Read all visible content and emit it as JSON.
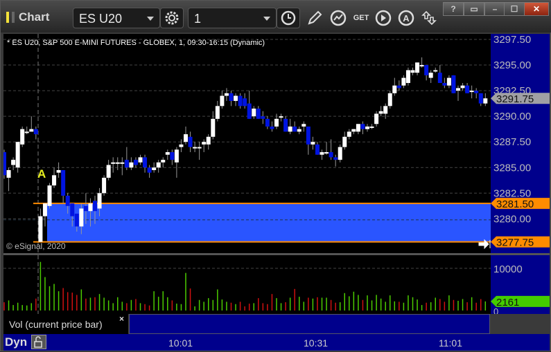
{
  "window": {
    "title": "Chart",
    "help": "?",
    "controls": [
      "restore-down",
      "minimize",
      "maximize",
      "close"
    ]
  },
  "toolbar": {
    "symbol": "ES U20",
    "interval": "1",
    "tools": [
      "gear-icon",
      "clock-icon",
      "pencil-icon",
      "studies-icon",
      "get-icon",
      "play-icon",
      "alert-icon",
      "link-arrows-icon"
    ]
  },
  "chart": {
    "legend": "* ES U20, S&P 500 E-MINI FUTURES - GLOBEX, 1, 09:30-16:15 (Dynamic)",
    "copyright": "© eSignal, 2020",
    "marker": "A",
    "price_ticks": [
      "3297.50",
      "3295.00",
      "3292.50",
      "3290.00",
      "3287.50",
      "3285.00",
      "3282.50",
      "3280.00"
    ],
    "price_tick_values": [
      3297.5,
      3295,
      3292.5,
      3290,
      3287.5,
      3285,
      3282.5,
      3280
    ],
    "last_price": "3291.75",
    "range_high": "3281.50",
    "range_low": "3277.75",
    "range_values": [
      3281.5,
      3277.75
    ],
    "colors": {
      "up": "#ffffff",
      "down": "#0014e0",
      "range_fill": "#2a55ff",
      "range_line": "#ff8c00",
      "axis_bg": "#00008c",
      "last_tag": "#a0a0a4",
      "vol_up": "#4ccc00",
      "vol_down": "#d01010",
      "vol_tag": "#44cc00"
    },
    "candles_ohlc": [
      [
        3286.5,
        3286.75,
        3283.9,
        3284.25
      ],
      [
        3284.0,
        3285.0,
        3282.7,
        3284.75
      ],
      [
        3285.25,
        3286.0,
        3284.75,
        3285.75
      ],
      [
        3285.0,
        3287.5,
        3284.5,
        3287.5
      ],
      [
        3287.25,
        3289.0,
        3287.0,
        3288.75
      ],
      [
        3288.5,
        3289.0,
        3288.25,
        3288.5
      ],
      [
        3288.5,
        3290.0,
        3288.5,
        3288.75
      ],
      [
        3288.75,
        3289.0,
        3287.75,
        3288.25
      ],
      [
        3277.75,
        3281.0,
        3277.75,
        3280.25
      ],
      [
        3280.25,
        3281.5,
        3279.25,
        3281.5
      ],
      [
        3281.25,
        3283.5,
        3281.0,
        3283.25
      ],
      [
        3283.25,
        3285.0,
        3283.0,
        3284.25
      ],
      [
        3284.5,
        3285.5,
        3284.0,
        3284.75
      ],
      [
        3284.75,
        3284.75,
        3281.5,
        3282.25
      ],
      [
        3282.25,
        3282.5,
        3280.5,
        3281.25
      ],
      [
        3281.5,
        3281.5,
        3279.25,
        3280.25
      ],
      [
        3280.5,
        3280.5,
        3278.75,
        3279.25
      ],
      [
        3279.25,
        3281.5,
        3278.5,
        3281.0
      ],
      [
        3281.25,
        3282.5,
        3279.5,
        3280.75
      ],
      [
        3280.75,
        3282.0,
        3279.25,
        3281.5
      ],
      [
        3281.75,
        3282.25,
        3279.5,
        3280.75
      ],
      [
        3281.0,
        3283.0,
        3280.25,
        3282.5
      ],
      [
        3282.5,
        3284.25,
        3282.25,
        3284.0
      ],
      [
        3284.0,
        3285.75,
        3283.75,
        3285.25
      ],
      [
        3285.5,
        3286.0,
        3284.5,
        3285.5
      ],
      [
        3285.5,
        3286.0,
        3284.75,
        3285.5
      ],
      [
        3285.5,
        3286.0,
        3284.25,
        3285.5
      ],
      [
        3285.75,
        3287.0,
        3284.75,
        3285.0
      ],
      [
        3285.0,
        3286.0,
        3284.75,
        3285.5
      ],
      [
        3285.75,
        3286.0,
        3285.0,
        3285.25
      ],
      [
        3285.5,
        3286.25,
        3285.25,
        3286.0
      ],
      [
        3286.0,
        3286.25,
        3284.5,
        3285.0
      ],
      [
        3285.0,
        3285.25,
        3284.0,
        3284.5
      ],
      [
        3284.75,
        3285.5,
        3284.5,
        3285.0
      ],
      [
        3285.0,
        3285.75,
        3284.5,
        3285.5
      ],
      [
        3285.5,
        3286.0,
        3285.0,
        3285.75
      ],
      [
        3286.25,
        3286.75,
        3285.75,
        3286.5
      ],
      [
        3286.5,
        3286.75,
        3285.25,
        3285.75
      ],
      [
        3285.5,
        3287.0,
        3284.0,
        3286.75
      ],
      [
        3287.0,
        3287.75,
        3286.5,
        3287.25
      ],
      [
        3287.5,
        3289.0,
        3287.25,
        3288.25
      ],
      [
        3288.0,
        3288.5,
        3286.5,
        3287.0
      ],
      [
        3287.0,
        3287.5,
        3286.5,
        3287.0
      ],
      [
        3287.0,
        3287.5,
        3285.75,
        3287.0
      ],
      [
        3287.25,
        3287.75,
        3286.5,
        3287.5
      ],
      [
        3287.25,
        3288.25,
        3286.75,
        3288.0
      ],
      [
        3288.0,
        3290.5,
        3287.75,
        3289.75
      ],
      [
        3289.75,
        3291.5,
        3289.5,
        3291.0
      ],
      [
        3291.0,
        3292.5,
        3290.75,
        3292.0
      ],
      [
        3292.0,
        3292.75,
        3291.5,
        3292.25
      ],
      [
        3292.25,
        3292.5,
        3291.0,
        3291.5
      ],
      [
        3291.5,
        3292.25,
        3291.0,
        3292.0
      ],
      [
        3292.0,
        3292.25,
        3290.75,
        3291.0
      ],
      [
        3291.75,
        3292.25,
        3290.75,
        3291.0
      ],
      [
        3291.25,
        3292.5,
        3289.75,
        3289.75
      ],
      [
        3290.0,
        3291.0,
        3289.75,
        3290.75
      ],
      [
        3290.75,
        3291.0,
        3289.75,
        3289.75
      ],
      [
        3290.0,
        3290.5,
        3289.25,
        3289.75
      ],
      [
        3289.75,
        3290.0,
        3288.75,
        3289.0
      ],
      [
        3289.0,
        3289.5,
        3288.5,
        3288.75
      ],
      [
        3289.0,
        3290.25,
        3288.75,
        3289.75
      ],
      [
        3290.0,
        3290.25,
        3289.5,
        3290.0
      ],
      [
        3289.75,
        3290.0,
        3288.5,
        3288.5
      ],
      [
        3288.5,
        3289.75,
        3288.25,
        3289.0
      ],
      [
        3289.0,
        3289.5,
        3288.5,
        3288.5
      ],
      [
        3288.5,
        3289.0,
        3288.25,
        3288.75
      ],
      [
        3289.0,
        3289.5,
        3288.5,
        3289.25
      ],
      [
        3289.0,
        3289.0,
        3286.25,
        3287.25
      ],
      [
        3287.25,
        3288.0,
        3286.75,
        3287.5
      ],
      [
        3287.25,
        3287.5,
        3286.25,
        3286.25
      ],
      [
        3286.25,
        3286.75,
        3285.75,
        3286.5
      ],
      [
        3286.5,
        3287.5,
        3286.25,
        3286.5
      ],
      [
        3286.5,
        3287.75,
        3285.75,
        3286.0
      ],
      [
        3286.0,
        3286.25,
        3285.1,
        3285.75
      ],
      [
        3285.75,
        3287.25,
        3285.5,
        3287.0
      ],
      [
        3287.0,
        3288.5,
        3286.75,
        3288.0
      ],
      [
        3288.0,
        3288.75,
        3287.75,
        3288.5
      ],
      [
        3288.5,
        3288.75,
        3288.25,
        3288.75
      ],
      [
        3288.5,
        3289.25,
        3288.25,
        3289.25
      ],
      [
        3289.25,
        3289.5,
        3288.25,
        3288.75
      ],
      [
        3288.75,
        3289.25,
        3288.5,
        3289.0
      ],
      [
        3289.0,
        3289.25,
        3288.75,
        3289.0
      ],
      [
        3289.25,
        3290.5,
        3289.0,
        3290.25
      ],
      [
        3290.25,
        3291.0,
        3290.0,
        3290.5
      ],
      [
        3290.25,
        3291.25,
        3289.75,
        3291.0
      ],
      [
        3291.0,
        3292.5,
        3290.75,
        3292.25
      ],
      [
        3292.25,
        3293.75,
        3292.0,
        3293.0
      ],
      [
        3293.0,
        3293.5,
        3292.5,
        3292.75
      ],
      [
        3293.0,
        3294.0,
        3292.75,
        3293.75
      ],
      [
        3293.25,
        3294.75,
        3293.0,
        3294.5
      ],
      [
        3294.25,
        3294.75,
        3294.0,
        3294.5
      ],
      [
        3294.25,
        3295.25,
        3294.0,
        3295.25
      ],
      [
        3295.0,
        3295.75,
        3294.75,
        3295.0
      ],
      [
        3295.0,
        3295.0,
        3293.5,
        3294.0
      ],
      [
        3293.75,
        3294.5,
        3293.25,
        3294.25
      ],
      [
        3294.5,
        3294.75,
        3294.25,
        3294.5
      ],
      [
        3294.25,
        3295.0,
        3293.25,
        3293.25
      ],
      [
        3293.25,
        3293.75,
        3292.75,
        3293.0
      ],
      [
        3293.0,
        3294.0,
        3292.75,
        3293.75
      ],
      [
        3294.0,
        3294.0,
        3292.25,
        3292.25
      ],
      [
        3292.5,
        3293.0,
        3291.5,
        3292.75
      ],
      [
        3292.75,
        3293.25,
        3292.5,
        3293.0
      ],
      [
        3293.0,
        3293.25,
        3292.25,
        3292.25
      ],
      [
        3292.5,
        3293.0,
        3291.75,
        3292.5
      ],
      [
        3292.5,
        3292.75,
        3291.75,
        3292.25
      ],
      [
        3292.25,
        3292.25,
        3291.0,
        3291.25
      ],
      [
        3291.25,
        3292.25,
        3291.0,
        3291.75
      ]
    ]
  },
  "volume": {
    "label": "Vol (current price bar)",
    "close": "×",
    "ticks": [
      "10000",
      "0"
    ],
    "current": "2161",
    "values": [
      1960,
      2390,
      1300,
      1850,
      1300,
      1200,
      1740,
      2830,
      11520,
      7930,
      5760,
      6300,
      4570,
      5330,
      4350,
      4240,
      3700,
      5000,
      2830,
      3040,
      3150,
      3910,
      3040,
      2390,
      1740,
      3150,
      2070,
      1740,
      2500,
      2720,
      1740,
      1520,
      1200,
      4570,
      3260,
      4570,
      3150,
      2390,
      1630,
      1520,
      8910,
      5220,
      980,
      2500,
      2070,
      2930,
      2500,
      5000,
      2610,
      2070,
      1850,
      1520,
      2070,
      980,
      1630,
      1740,
      2930,
      1740,
      1520,
      3910,
      2930,
      1740,
      1960,
      3040,
      5110,
      3260,
      2070,
      3040,
      2830,
      3150,
      3040,
      3040,
      2500,
      1850,
      1960,
      4130,
      3370,
      4460,
      3700,
      2500,
      3590,
      2390,
      3700,
      2830,
      2070,
      3590,
      2170,
      2070,
      1850,
      3590,
      3150,
      2610,
      1300,
      1850,
      1960,
      3040,
      2720,
      2070,
      3590,
      2500,
      2300,
      2720,
      1960,
      3150,
      1850,
      2700,
      2161
    ]
  },
  "time_axis": {
    "mode": "Dyn",
    "labels": [
      "10:01",
      "10:31",
      "11:01"
    ]
  }
}
